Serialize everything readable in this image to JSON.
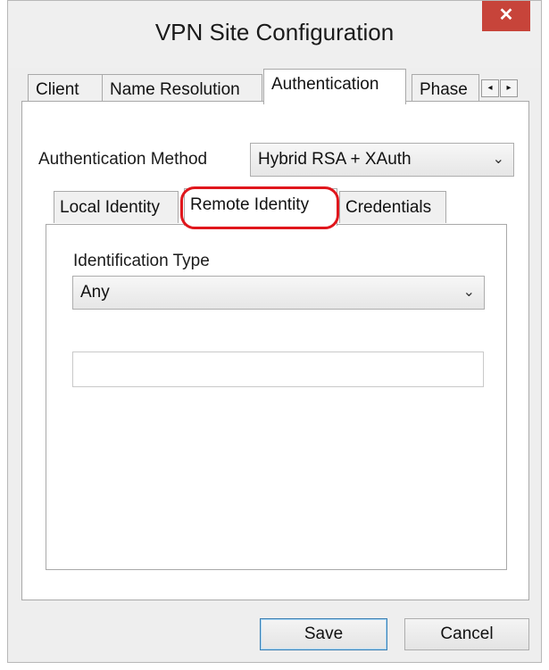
{
  "window": {
    "title": "VPN Site Configuration",
    "close_glyph": "✕"
  },
  "tabs": [
    "Client",
    "Name Resolution",
    "Authentication",
    "Phase"
  ],
  "tab_scroll": {
    "left": "◂",
    "right": "▸"
  },
  "auth": {
    "label": "Authentication Method",
    "value": "Hybrid RSA + XAuth"
  },
  "inner_tabs": [
    "Local Identity",
    "Remote Identity",
    "Credentials"
  ],
  "identification": {
    "label": "Identification Type",
    "value": "Any",
    "text_value": ""
  },
  "dropdown_glyph": "⌄",
  "buttons": {
    "save": "Save",
    "cancel": "Cancel"
  },
  "colors": {
    "close": "#c7443a",
    "highlight": "#e0161c"
  }
}
